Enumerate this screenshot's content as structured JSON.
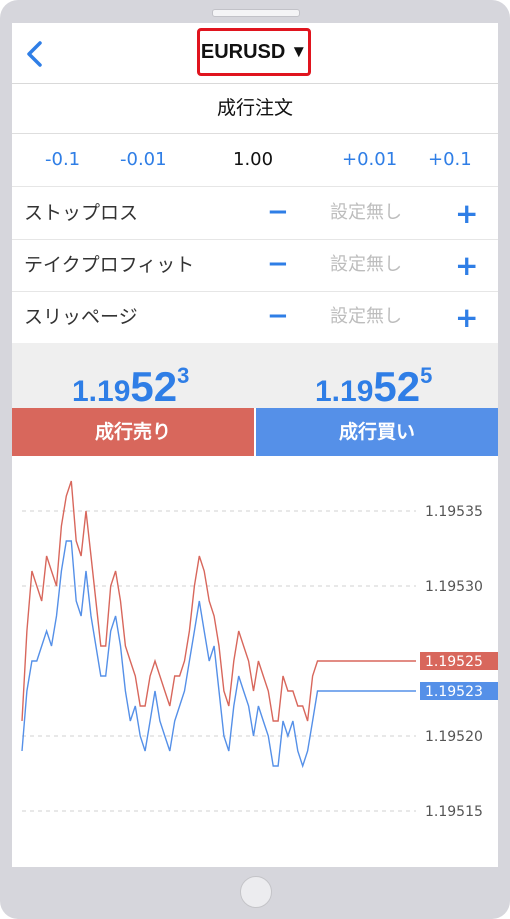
{
  "header": {
    "symbol": "EURUSD",
    "symbol_caret": "▼",
    "title": "成行注文"
  },
  "lot_stepper": {
    "dec_large": "-0.1",
    "dec_small": "-0.01",
    "value": "1.00",
    "inc_small": "+0.01",
    "inc_large": "+0.1"
  },
  "settings": [
    {
      "label": "ストップロス",
      "minus": "−",
      "value": "設定無し",
      "plus": "+"
    },
    {
      "label": "テイクプロフィット",
      "minus": "−",
      "value": "設定無し",
      "plus": "+"
    },
    {
      "label": "スリッページ",
      "minus": "−",
      "value": "設定無し",
      "plus": "+"
    }
  ],
  "quotes": {
    "sell": {
      "prefix": "1.19",
      "big": "52",
      "sup": "3"
    },
    "buy": {
      "prefix": "1.19",
      "big": "52",
      "sup": "5"
    }
  },
  "buttons": {
    "sell_label": "成行売り",
    "buy_label": "成行買い"
  },
  "colors": {
    "accent_blue": "#2f7ee6",
    "sell_red": "#d8675c",
    "buy_blue": "#5590e8"
  },
  "chart_data": {
    "type": "line",
    "ylim": [
      1.19512,
      1.19538
    ],
    "y_ticks": [
      "1.19535",
      "1.19530",
      "1.19520",
      "1.19515"
    ],
    "current_labels": [
      {
        "series": "ask",
        "value": "1.19525",
        "color": "#d8675c"
      },
      {
        "series": "bid",
        "value": "1.19523",
        "color": "#5590e8"
      }
    ],
    "series": [
      {
        "color": "#d8675c",
        "values": [
          1.19521,
          1.19527,
          1.19531,
          1.1953,
          1.19529,
          1.19532,
          1.19531,
          1.1953,
          1.19534,
          1.19536,
          1.19537,
          1.19533,
          1.19532,
          1.19535,
          1.19532,
          1.19529,
          1.19526,
          1.19526,
          1.1953,
          1.19531,
          1.19529,
          1.19526,
          1.19525,
          1.19524,
          1.19522,
          1.19522,
          1.19524,
          1.19525,
          1.19524,
          1.19523,
          1.19522,
          1.19524,
          1.19524,
          1.19525,
          1.19527,
          1.1953,
          1.19532,
          1.19531,
          1.19529,
          1.19528,
          1.19526,
          1.19523,
          1.19522,
          1.19525,
          1.19527,
          1.19526,
          1.19525,
          1.19523,
          1.19525,
          1.19524,
          1.19523,
          1.19521,
          1.19521,
          1.19524,
          1.19523,
          1.19523,
          1.19522,
          1.19522,
          1.19521,
          1.19524,
          1.19525,
          1.19525,
          1.19525,
          1.19525,
          1.19525,
          1.19525,
          1.19525,
          1.19525,
          1.19525,
          1.19525,
          1.19525,
          1.19525,
          1.19525,
          1.19525,
          1.19525,
          1.19525,
          1.19525,
          1.19525,
          1.19525,
          1.19525,
          1.19525
        ]
      },
      {
        "color": "#5590e8",
        "values": [
          1.19519,
          1.19523,
          1.19525,
          1.19525,
          1.19526,
          1.19527,
          1.19526,
          1.19528,
          1.19531,
          1.19533,
          1.19533,
          1.19529,
          1.19528,
          1.19531,
          1.19528,
          1.19526,
          1.19524,
          1.19524,
          1.19527,
          1.19528,
          1.19526,
          1.19523,
          1.19521,
          1.19522,
          1.1952,
          1.19519,
          1.19521,
          1.19523,
          1.19521,
          1.1952,
          1.19519,
          1.19521,
          1.19522,
          1.19523,
          1.19525,
          1.19527,
          1.19529,
          1.19527,
          1.19525,
          1.19526,
          1.19523,
          1.1952,
          1.19519,
          1.19522,
          1.19524,
          1.19523,
          1.19522,
          1.1952,
          1.19522,
          1.19521,
          1.1952,
          1.19518,
          1.19518,
          1.19521,
          1.1952,
          1.19521,
          1.19519,
          1.19518,
          1.19519,
          1.19521,
          1.19523,
          1.19523,
          1.19523,
          1.19523,
          1.19523,
          1.19523,
          1.19523,
          1.19523,
          1.19523,
          1.19523,
          1.19523,
          1.19523,
          1.19523,
          1.19523,
          1.19523,
          1.19523,
          1.19523,
          1.19523,
          1.19523,
          1.19523,
          1.19523
        ]
      }
    ]
  }
}
